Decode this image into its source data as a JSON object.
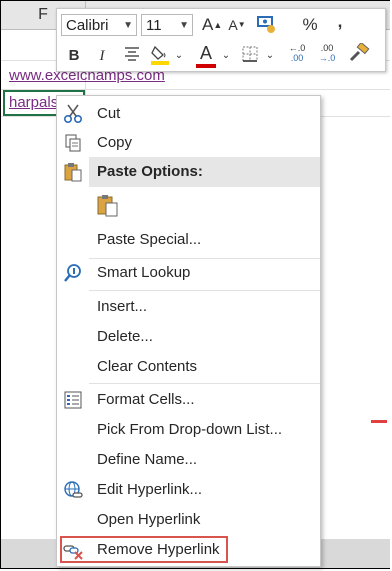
{
  "sheet": {
    "column_label": "F",
    "cell1": "www.excelchamps.com",
    "cell2": "harpals"
  },
  "mini_toolbar": {
    "font_name": "Calibri",
    "font_size": "11",
    "grow_font": "A",
    "shrink_font": "A",
    "percent": "%",
    "comma": ",",
    "bold": "B",
    "italic": "I",
    "font_color_letter": "A",
    "font_color": "#d00000",
    "fill_color": "#ffd700",
    "inc_decimal": ".00",
    "dec_decimal": "←.0"
  },
  "menu": {
    "cut": "Cut",
    "copy": "Copy",
    "paste_options": "Paste Options:",
    "paste_special": "Paste Special...",
    "smart_lookup": "Smart Lookup",
    "insert": "Insert...",
    "delete": "Delete...",
    "clear_contents": "Clear Contents",
    "format_cells": "Format Cells...",
    "pick_dropdown": "Pick From Drop-down List...",
    "define_name": "Define Name...",
    "edit_hyperlink": "Edit Hyperlink...",
    "open_hyperlink": "Open Hyperlink",
    "remove_hyperlink": "Remove Hyperlink"
  },
  "colors": {
    "link": "#7a2b83",
    "highlight_box": "#d9534f",
    "selection": "#217346"
  }
}
